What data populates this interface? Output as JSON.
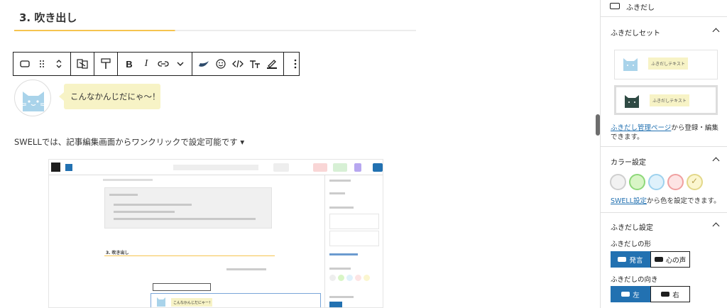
{
  "editor": {
    "heading": "3. 吹き出し",
    "balloon_text": "こんなかんじだにゃ〜！",
    "paragraph": "SWELLでは、記事編集画面からワンクリックで設定可能です",
    "paragraph_icon": "triangle-down-icon",
    "toolbar": {
      "icons": [
        "balloon-block-icon",
        "drag-handle-icon",
        "move-up-down-icon",
        "swap-icon",
        "style-brush-icon",
        "bold-icon",
        "italic-icon",
        "link-icon",
        "chevron-down-icon",
        "swell-bird-icon",
        "emoji-icon",
        "code-icon",
        "text-size-icon",
        "highlight-icon",
        "more-options-icon"
      ],
      "bold": "B",
      "italic": "I"
    }
  },
  "embedded_screenshot": {
    "heading": "3. 吹き出し",
    "balloon_text": "こんなかんじだにゃー！"
  },
  "sidebar": {
    "block_name": "ふきだし",
    "preset_panel": {
      "title": "ふきだしセット",
      "presets": [
        {
          "text": "ふきだしテキスト"
        },
        {
          "text": "ふきだしテキスト"
        }
      ],
      "note_link": "ふきだし管理ページ",
      "note_text": "から登録・編集できます。"
    },
    "color_panel": {
      "title": "カラー設定",
      "colors": [
        "#f2f2f2",
        "#d8f5c6",
        "#dff1fb",
        "#fde4e4",
        "#fbf6cf"
      ],
      "borders": [
        "#cfcfcf",
        "#8ed87a",
        "#9ed2ee",
        "#f0a0a0",
        "#e3d88a"
      ],
      "selected_index": 4,
      "note_link": "SWELL設定",
      "note_text": "から色を設定できます。"
    },
    "balloon_panel": {
      "title": "ふきだし設定",
      "shape_label": "ふきだしの形",
      "shape_options": [
        "発言",
        "心の声"
      ],
      "shape_active": 0,
      "direction_label": "ふきだしの向き",
      "direction_options": [
        "左",
        "右"
      ],
      "direction_active": 0
    },
    "accent_color": "#2271b1"
  }
}
